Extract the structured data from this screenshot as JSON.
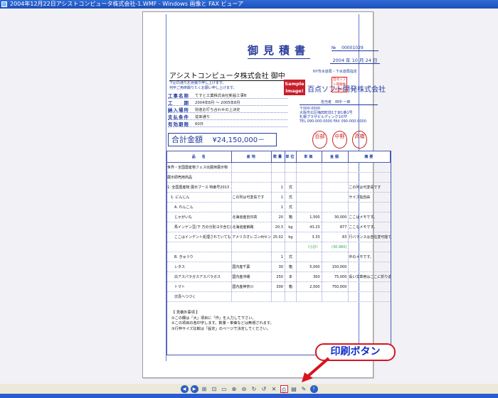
{
  "window": {
    "title": "2004年12月22日アシストコンピュータ株式会社-1.WMF - Windows 画像と FAX ビューア"
  },
  "document": {
    "title": "御見積書",
    "number_label": "№",
    "number": "00001029",
    "date": "2004 年 10 月 24 日",
    "client": "アシストコンピュータ株式会社 御中",
    "greeting_1": "下記の通りお見積り申し上げます。",
    "greeting_2": "何卒ご用命賜りたくお願い申し上げます。",
    "details": [
      {
        "label": "工事名称",
        "value": "てすと工業株式会社新設工事B"
      },
      {
        "label": "工　　期",
        "value": "2004年8月 ～ 2005年8月"
      },
      {
        "label": "納入場所",
        "value": "別途お打ち合わせの上決定"
      },
      {
        "label": "支払条件",
        "value": "従来通り"
      },
      {
        "label": "有効期限",
        "value": "60日"
      }
    ],
    "vendor_head": "NY市水道局・下水道局指定",
    "sample_label": "Sample Image!",
    "company": "百点ソフト開発株式会社",
    "seal_text": "百点ソフト開発株式会社",
    "person": "担当者　田中 一郎",
    "address": [
      "〒000-0000",
      "大阪市北区梅田町前1丁目1番1号",
      "札幌プラザビルディング107F",
      "TEL 090-000-0000  FAX 090-000-0000"
    ],
    "total_label": "合計金額",
    "total_amount": "¥24,150,000－",
    "stamps": [
      "百部",
      "中野",
      "高橋"
    ]
  },
  "table": {
    "headers": [
      "品　名",
      "産地",
      "数量",
      "単位",
      "単価",
      "金額",
      "摘要"
    ],
    "rows": [
      [
        "世界・全国農産物フェス出展用展示物",
        "",
        "",
        "",
        "",
        "",
        ""
      ],
      [
        "展示即売用商品",
        "",
        "",
        "",
        "",
        "",
        ""
      ],
      [
        "1. 全国農産物 展示ブース 特番号2013",
        "",
        "1",
        "式",
        "",
        "",
        "この列は可変長です"
      ],
      [
        "　1. にんじん",
        "この列は可変長です",
        "1",
        "式",
        "",
        "",
        "サイズ指自由"
      ],
      [
        "　　A. れんこん",
        "",
        "1",
        "式",
        "",
        "",
        ""
      ],
      [
        "　　じゃがいも",
        "北海道産自日高",
        "20",
        "箱",
        "1,500",
        "30,000",
        "ここはメモです。"
      ],
      [
        "　　馬インゲン豆(下 万の分別ヨタ含む)",
        "北海道産釧路",
        "20.3",
        "kg",
        "43.23",
        "877",
        "ここもメモです。"
      ],
      [
        "　　ここはインデント処理されていても設定可能です。",
        "アメリカオレゴン州セン",
        "25.02",
        "kg",
        "3.33",
        "83",
        "行バランスは自在変可能です。"
      ],
      [
        "",
        "",
        "",
        "",
        "〔小計〕",
        "(30,960)",
        ""
      ],
      [
        "　　B. きゅうり",
        "",
        "1",
        "式",
        "",
        "",
        "中のメモです。"
      ],
      [
        "　　レタス",
        "国内産千葉",
        "30",
        "箱",
        "5,000",
        "150,000",
        ""
      ],
      [
        "　　白アスパラガスアスパラガス",
        "国内産沖縄",
        "250",
        "本",
        "300",
        "75,000",
        "長い文章用はここに折り返して印刷します。"
      ],
      [
        "　　トマト",
        "国内産神奈川",
        "300",
        "箱",
        "2,500",
        "750,000",
        ""
      ],
      [
        "　　次頁へつづく",
        "",
        "",
        "",
        "",
        "",
        ""
      ]
    ],
    "memo_title": "【 見積外事項 】",
    "memo": [
      "①この欄は「大」項目に「作」を入力して下さい。",
      "②この項目の各印字します。数量・単価などは無視されます。",
      "③行枠サイズ比較は「設定」のページで決定してください。"
    ]
  },
  "annotation": {
    "label": "印刷ボタン"
  },
  "toolbar": {
    "buttons": [
      "prev-icon",
      "next-icon",
      "best-fit-icon",
      "actual-size-icon",
      "slideshow-icon",
      "zoom-in-icon",
      "zoom-out-icon",
      "rotate-cw-icon",
      "rotate-ccw-icon",
      "delete-icon",
      "print-icon",
      "copy-to-icon",
      "edit-icon",
      "help-icon"
    ]
  }
}
